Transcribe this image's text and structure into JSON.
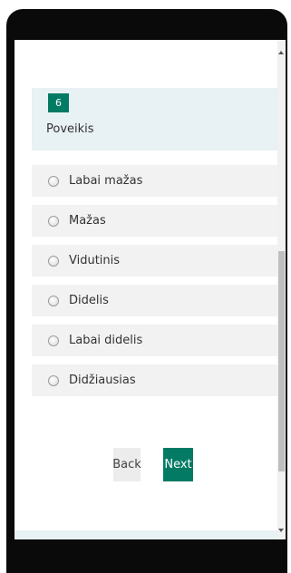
{
  "question": {
    "number": "6",
    "title": "Poveikis"
  },
  "options": [
    {
      "label": "Labai mažas"
    },
    {
      "label": "Mažas"
    },
    {
      "label": "Vidutinis"
    },
    {
      "label": "Didelis"
    },
    {
      "label": "Labai didelis"
    },
    {
      "label": "Didžiausias"
    }
  ],
  "nav": {
    "back_label": "Back",
    "next_label": "Next"
  },
  "colors": {
    "accent": "#027a64",
    "card_bg": "#e8f1f4",
    "option_bg": "#f2f2f2"
  }
}
